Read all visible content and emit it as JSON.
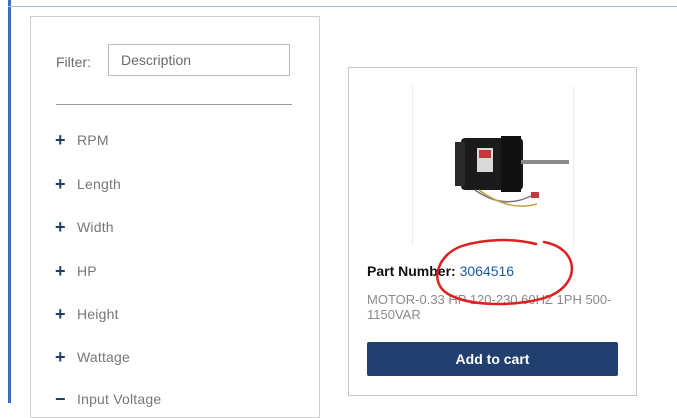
{
  "filter": {
    "label": "Filter:",
    "placeholder": "Description"
  },
  "facets": [
    {
      "sign": "+",
      "label": "RPM"
    },
    {
      "sign": "+",
      "label": "Length"
    },
    {
      "sign": "+",
      "label": "Width"
    },
    {
      "sign": "+",
      "label": "HP"
    },
    {
      "sign": "+",
      "label": "Height"
    },
    {
      "sign": "+",
      "label": "Wattage"
    },
    {
      "sign": "−",
      "label": "Input Voltage"
    }
  ],
  "product": {
    "part_label": "Part Number:",
    "part_number": "3064516",
    "description": "MOTOR-0.33 HP 120-230 60HZ 1PH 500-1150VAR",
    "button_label": "Add to cart",
    "image_icon": "motor-product-image"
  },
  "colors": {
    "accent": "#21406f",
    "link": "#1d5aa8",
    "annotation": "#e0201f"
  }
}
